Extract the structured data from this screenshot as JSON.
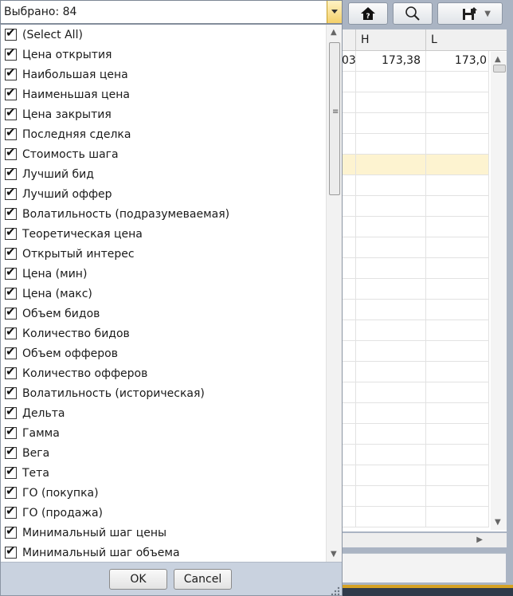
{
  "combo": {
    "selected_text": "Выбрано: 84"
  },
  "grid": {
    "columns": [
      "H",
      "L"
    ],
    "first_row": {
      "partial": "03",
      "h": "173,38",
      "l": "173,0"
    }
  },
  "list_items": [
    "(Select All)",
    "Цена открытия",
    "Наибольшая цена",
    "Наименьшая цена",
    "Цена закрытия",
    "Последняя сделка",
    "Стоимость шага",
    "Лучший бид",
    "Лучший оффер",
    "Волатильность (подразумеваемая)",
    "Теоретическая цена",
    "Открытый интерес",
    "Цена (мин)",
    "Цена (макс)",
    "Объем бидов",
    "Количество бидов",
    "Объем офферов",
    "Количество офферов",
    "Волатильность (историческая)",
    "Дельта",
    "Гамма",
    "Вега",
    "Тета",
    "ГО (покупка)",
    "ГО (продажа)",
    "Минимальный шаг цены",
    "Минимальный шаг объема"
  ],
  "footer": {
    "ok_label": "OK",
    "cancel_label": "Cancel"
  },
  "icons": [
    "home-alert-icon",
    "search-icon",
    "save-icon",
    "dropdown-arrow-icon"
  ],
  "colors": {
    "accent": "#f4d06a",
    "highlight_row": "#fdf3d0"
  }
}
